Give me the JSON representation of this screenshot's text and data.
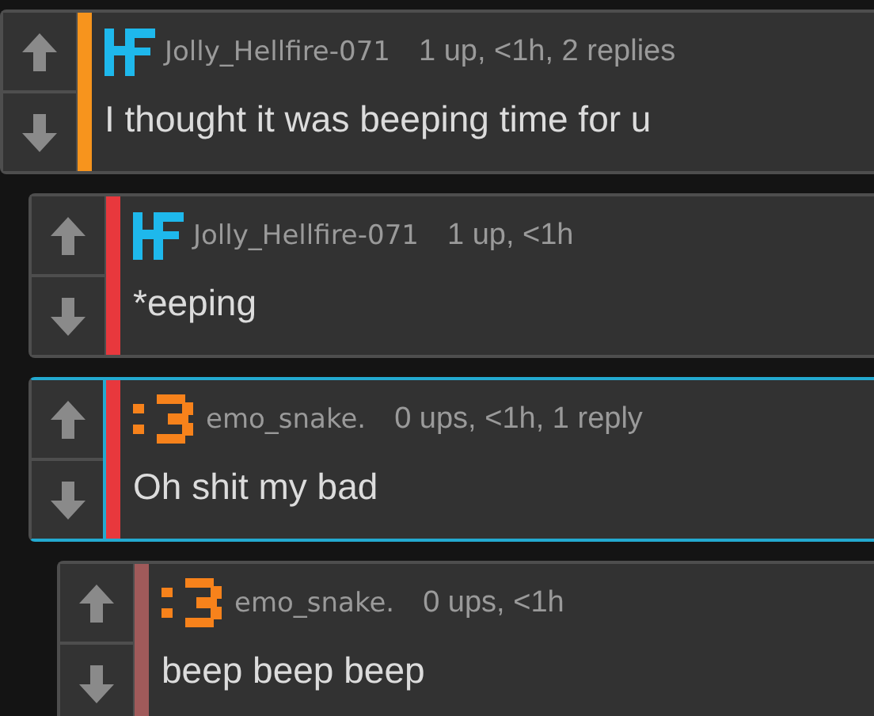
{
  "comments": [
    {
      "kind": "hf",
      "username": "Jolly_Hellfire-071",
      "meta": "1 up, <1h, 2 replies",
      "text": "I thought it was beeping time for u",
      "color": "#f7941d",
      "highlighted": false,
      "children": [
        {
          "kind": "hf",
          "username": "Jolly_Hellfire-071",
          "meta": "1 up, <1h",
          "text": "*eeping",
          "color": "#e8383d",
          "highlighted": false
        },
        {
          "kind": "cat",
          "username": "emo_snake.",
          "meta": "0 ups, <1h, 1 reply",
          "text": "Oh shit my bad",
          "color": "#e8383d",
          "highlighted": true,
          "children": [
            {
              "kind": "cat",
              "username": "emo_snake.",
              "meta": "0 ups, <1h",
              "text": "beep beep beep",
              "color": "#a05a5a",
              "highlighted": false
            }
          ]
        }
      ]
    }
  ]
}
